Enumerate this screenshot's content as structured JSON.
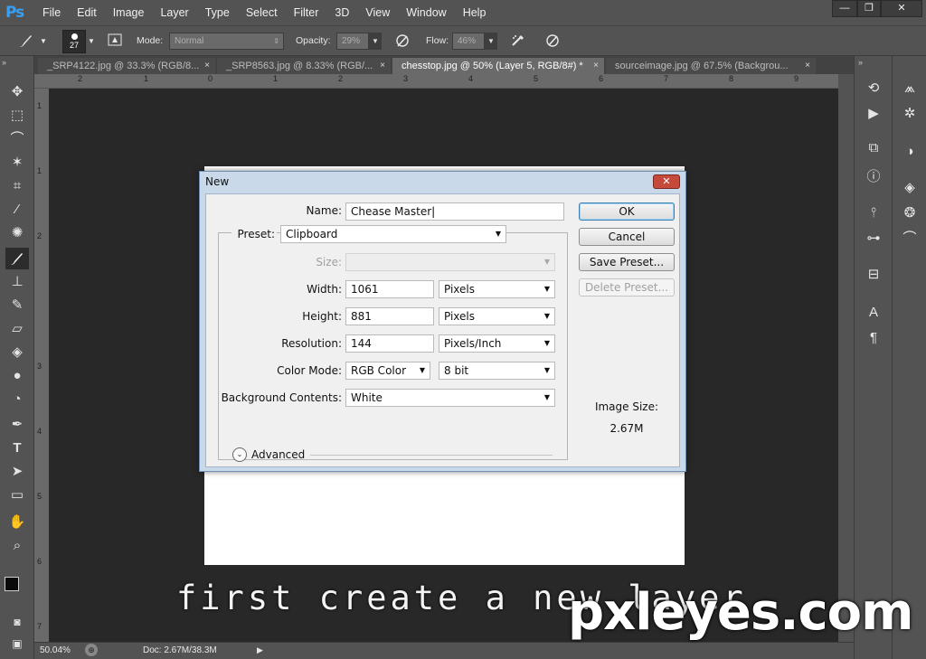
{
  "app": {
    "logo": "Ps"
  },
  "menu": [
    "File",
    "Edit",
    "Image",
    "Layer",
    "Type",
    "Select",
    "Filter",
    "3D",
    "View",
    "Window",
    "Help"
  ],
  "window_controls": {
    "minimize": "—",
    "restore": "❐",
    "close": "✕"
  },
  "options_bar": {
    "brush_size": "27",
    "mode_label": "Mode:",
    "mode_value": "Normal",
    "opacity_label": "Opacity:",
    "opacity_value": "29%",
    "flow_label": "Flow:",
    "flow_value": "46%"
  },
  "tabs": [
    {
      "label": "_SRP4122.jpg @ 33.3% (RGB/8...",
      "close": "×"
    },
    {
      "label": "_SRP8563.jpg @ 8.33% (RGB/...",
      "close": "×"
    },
    {
      "label": "chesstop.jpg @ 50% (Layer 5, RGB/8#) *",
      "close": "×"
    },
    {
      "label": "sourceimage.jpg @ 67.5% (Backgrou...",
      "close": "×"
    }
  ],
  "ruler_top": [
    "2",
    "1",
    "0",
    "1",
    "2",
    "3",
    "4",
    "5",
    "6",
    "7",
    "8",
    "9"
  ],
  "ruler_left": [
    "1",
    "1",
    "2",
    "3",
    "4",
    "5",
    "6",
    "7"
  ],
  "status": {
    "zoom": "50.04%",
    "doc": "Doc: 2.67M/38.3M"
  },
  "dialog": {
    "title": "New",
    "close": "✕",
    "name_label": "Name:",
    "name_value": "Chease Master",
    "preset_label": "Preset:",
    "preset_value": "Clipboard",
    "size_label": "Size:",
    "size_value": "",
    "width_label": "Width:",
    "width_value": "1061",
    "width_unit": "Pixels",
    "height_label": "Height:",
    "height_value": "881",
    "height_unit": "Pixels",
    "resolution_label": "Resolution:",
    "resolution_value": "144",
    "resolution_unit": "Pixels/Inch",
    "color_mode_label": "Color Mode:",
    "color_mode_value": "RGB Color",
    "bit_depth": "8 bit",
    "background_label": "Background Contents:",
    "background_value": "White",
    "advanced_label": "Advanced",
    "ok": "OK",
    "cancel": "Cancel",
    "save_preset": "Save Preset...",
    "delete_preset": "Delete Preset...",
    "image_size_label": "Image Size:",
    "image_size_value": "2.67M"
  },
  "overlay": {
    "caption": "first create a new layer",
    "watermark": "pxleyes.com"
  }
}
